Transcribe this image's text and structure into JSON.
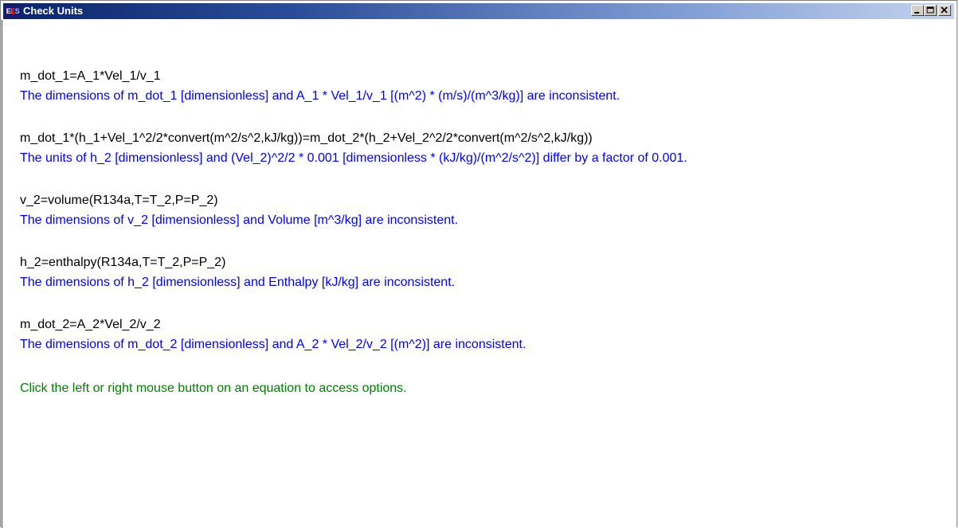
{
  "window": {
    "title": "Check Units",
    "icon_text": "EES"
  },
  "title_controls": {
    "minimize_icon": "minimize-icon",
    "maximize_icon": "maximize-icon",
    "close_icon": "close-icon"
  },
  "entries": [
    {
      "equation": "m_dot_1=A_1*Vel_1/v_1",
      "message": "The dimensions of m_dot_1 [dimensionless] and A_1 * Vel_1/v_1 [(m^2) * (m/s)/(m^3/kg)] are inconsistent."
    },
    {
      "equation": "m_dot_1*(h_1+Vel_1^2/2*convert(m^2/s^2,kJ/kg))=m_dot_2*(h_2+Vel_2^2/2*convert(m^2/s^2,kJ/kg))",
      "message": "The units of h_2 [dimensionless] and (Vel_2)^2/2 * 0.001 [dimensionless * (kJ/kg)/(m^2/s^2)] differ by a factor of 0.001."
    },
    {
      "equation": "v_2=volume(R134a,T=T_2,P=P_2)",
      "message": "The dimensions of v_2 [dimensionless] and Volume [m^3/kg] are inconsistent."
    },
    {
      "equation": "h_2=enthalpy(R134a,T=T_2,P=P_2)",
      "message": "The dimensions of h_2 [dimensionless] and Enthalpy [kJ/kg] are inconsistent."
    },
    {
      "equation": "m_dot_2=A_2*Vel_2/v_2",
      "message": "The dimensions of m_dot_2 [dimensionless] and A_2 * Vel_2/v_2 [(m^2)] are inconsistent."
    }
  ],
  "hint": "Click the left or right mouse button on an equation to access options.",
  "colors": {
    "equation": "#000000",
    "message": "#0000ff",
    "hint": "#008000",
    "titlebar_start": "#0a246a",
    "titlebar_end": "#c4d4ee"
  }
}
